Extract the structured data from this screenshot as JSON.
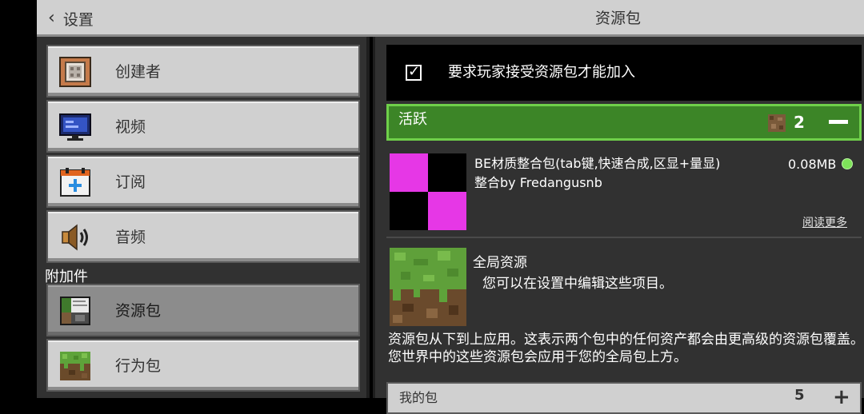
{
  "header": {
    "back_label": "设置",
    "title": "资源包"
  },
  "sidebar": {
    "items": [
      {
        "label": "创建者",
        "icon": "creator-icon"
      },
      {
        "label": "视频",
        "icon": "video-icon"
      },
      {
        "label": "订阅",
        "icon": "subscription-icon"
      },
      {
        "label": "音频",
        "icon": "audio-icon"
      }
    ],
    "section_label": "附加件",
    "addon_items": [
      {
        "label": "资源包",
        "icon": "resource-pack-icon",
        "selected": true
      },
      {
        "label": "行为包",
        "icon": "behavior-pack-icon"
      }
    ]
  },
  "content": {
    "require_label": "要求玩家接受资源包才能加入",
    "require_checked": true,
    "active": {
      "label": "活跃",
      "count": "2"
    },
    "pack": {
      "name": "BE材质整合包(tab键,快速合成,区显+量显)",
      "author": "整合by Fredangusnb",
      "size": "0.08MB",
      "read_more": "阅读更多"
    },
    "global": {
      "title": "全局资源",
      "desc": "您可以在设置中编辑这些项目。"
    },
    "info": "资源包从下到上应用。这表示两个包中的任何资产都会由更高级的资源包覆盖。您世界中的这些资源包会应用于您的全局包上方。",
    "my_packs": {
      "label": "我的包",
      "count": "5"
    }
  },
  "colors": {
    "active_green": "#3c8527",
    "active_border": "#6fd04a",
    "status_dot": "#7ee35a",
    "button_gray": "#d0d0d0"
  }
}
